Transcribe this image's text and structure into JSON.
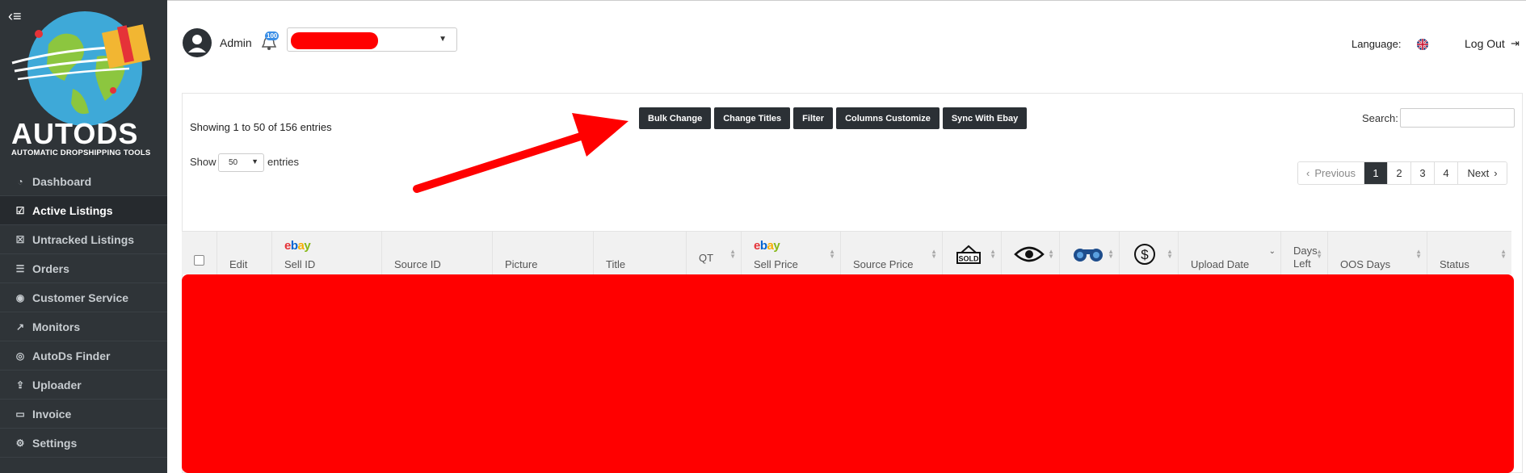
{
  "brand": {
    "name": "AUTODS",
    "tagline": "AUTOMATIC DROPSHIPPING TOOLS"
  },
  "sidebar": {
    "items": [
      {
        "label": "Dashboard",
        "icon": "dashboard-icon"
      },
      {
        "label": "Active Listings",
        "icon": "calendar-check-icon",
        "active": true
      },
      {
        "label": "Untracked Listings",
        "icon": "calendar-x-icon"
      },
      {
        "label": "Orders",
        "icon": "cart-icon"
      },
      {
        "label": "Customer Service",
        "icon": "user-circle-icon"
      },
      {
        "label": "Monitors",
        "icon": "chart-line-icon"
      },
      {
        "label": "AutoDs Finder",
        "icon": "target-icon"
      },
      {
        "label": "Uploader",
        "icon": "upload-icon"
      },
      {
        "label": "Invoice",
        "icon": "credit-card-icon"
      },
      {
        "label": "Settings",
        "icon": "gear-icon"
      }
    ]
  },
  "header": {
    "user": "Admin",
    "notifications": "100",
    "language_label": "Language:",
    "logout_label": "Log Out"
  },
  "listing": {
    "info": "Showing 1 to 50 of 156 entries",
    "show_label": "Show",
    "page_size": "50",
    "entries_label": "entries",
    "search_label": "Search:",
    "search_placeholder": "",
    "buttons": [
      "Bulk Change",
      "Change Titles",
      "Filter",
      "Columns Customize",
      "Sync With Ebay"
    ],
    "pagination": {
      "previous": "Previous",
      "pages": [
        "1",
        "2",
        "3",
        "4"
      ],
      "current": "1",
      "next": "Next"
    },
    "columns": {
      "edit": "Edit",
      "sell_id": "Sell ID",
      "source_id": "Source ID",
      "picture": "Picture",
      "title": "Title",
      "qt": "QT",
      "sell_price": "Sell Price",
      "source_price": "Source Price",
      "upload_date": "Upload Date",
      "days_left_1": "Days",
      "days_left_2": "Left",
      "oos_days": "OOS Days",
      "status": "Status",
      "ebay_logo": "ebay",
      "sold_icon_text": "SOLD"
    }
  },
  "colors": {
    "sidebar_bg": "#2f3438",
    "button_bg": "#2b3035",
    "redaction": "#ff0000",
    "accent": "#3a8ee6"
  }
}
